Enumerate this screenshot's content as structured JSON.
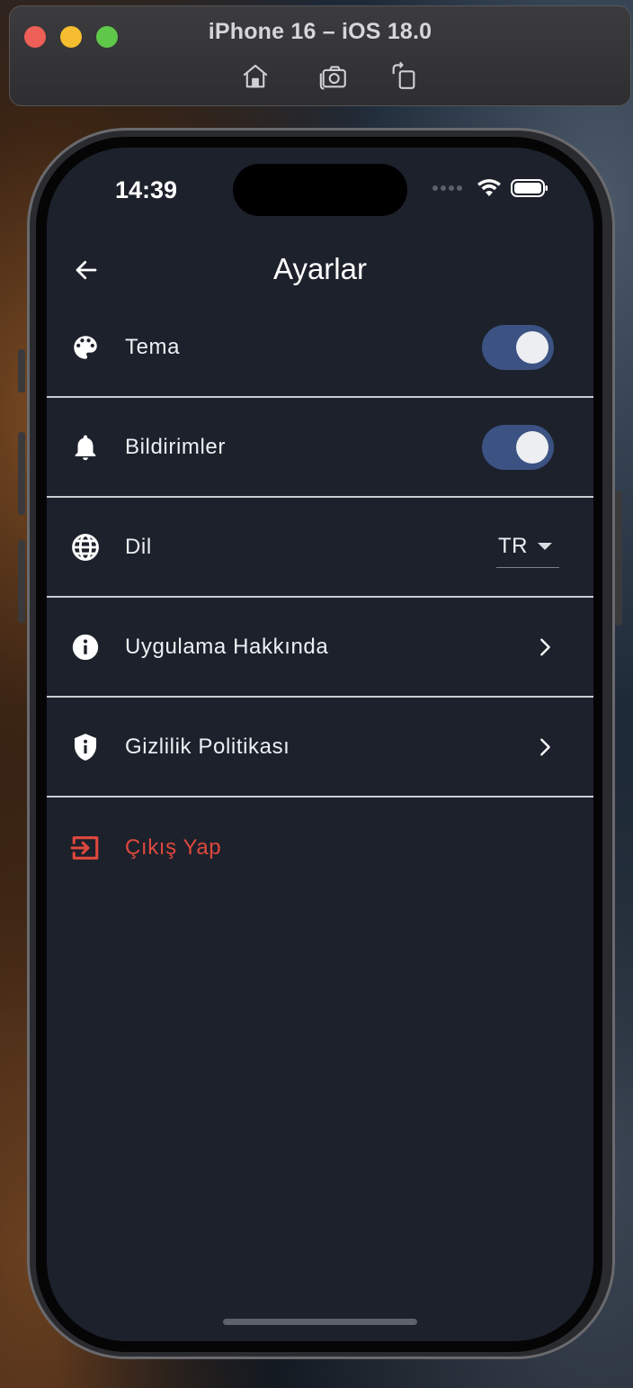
{
  "simulator": {
    "title": "iPhone 16 – iOS 18.0",
    "tools": [
      "home-icon",
      "screenshot-icon",
      "rotate-icon"
    ]
  },
  "status_bar": {
    "time": "14:39"
  },
  "app_bar": {
    "title": "Ayarlar",
    "back_icon": "arrow-back-icon"
  },
  "settings": {
    "theme": {
      "label": "Tema",
      "icon": "palette-icon",
      "enabled": true
    },
    "notifications": {
      "label": "Bildirimler",
      "icon": "bell-icon",
      "enabled": true
    },
    "language": {
      "label": "Dil",
      "icon": "globe-icon",
      "value": "TR"
    },
    "about": {
      "label": "Uygulama Hakkında",
      "icon": "info-icon"
    },
    "privacy": {
      "label": "Gizlilik Politikası",
      "icon": "shield-icon"
    },
    "logout": {
      "label": "Çıkış Yap",
      "icon": "logout-icon"
    }
  },
  "colors": {
    "background": "#1c212b",
    "toggle_track": "#3b5282",
    "danger": "#e0483e",
    "text": "#eef0f4",
    "divider": "#c9ccd2"
  }
}
